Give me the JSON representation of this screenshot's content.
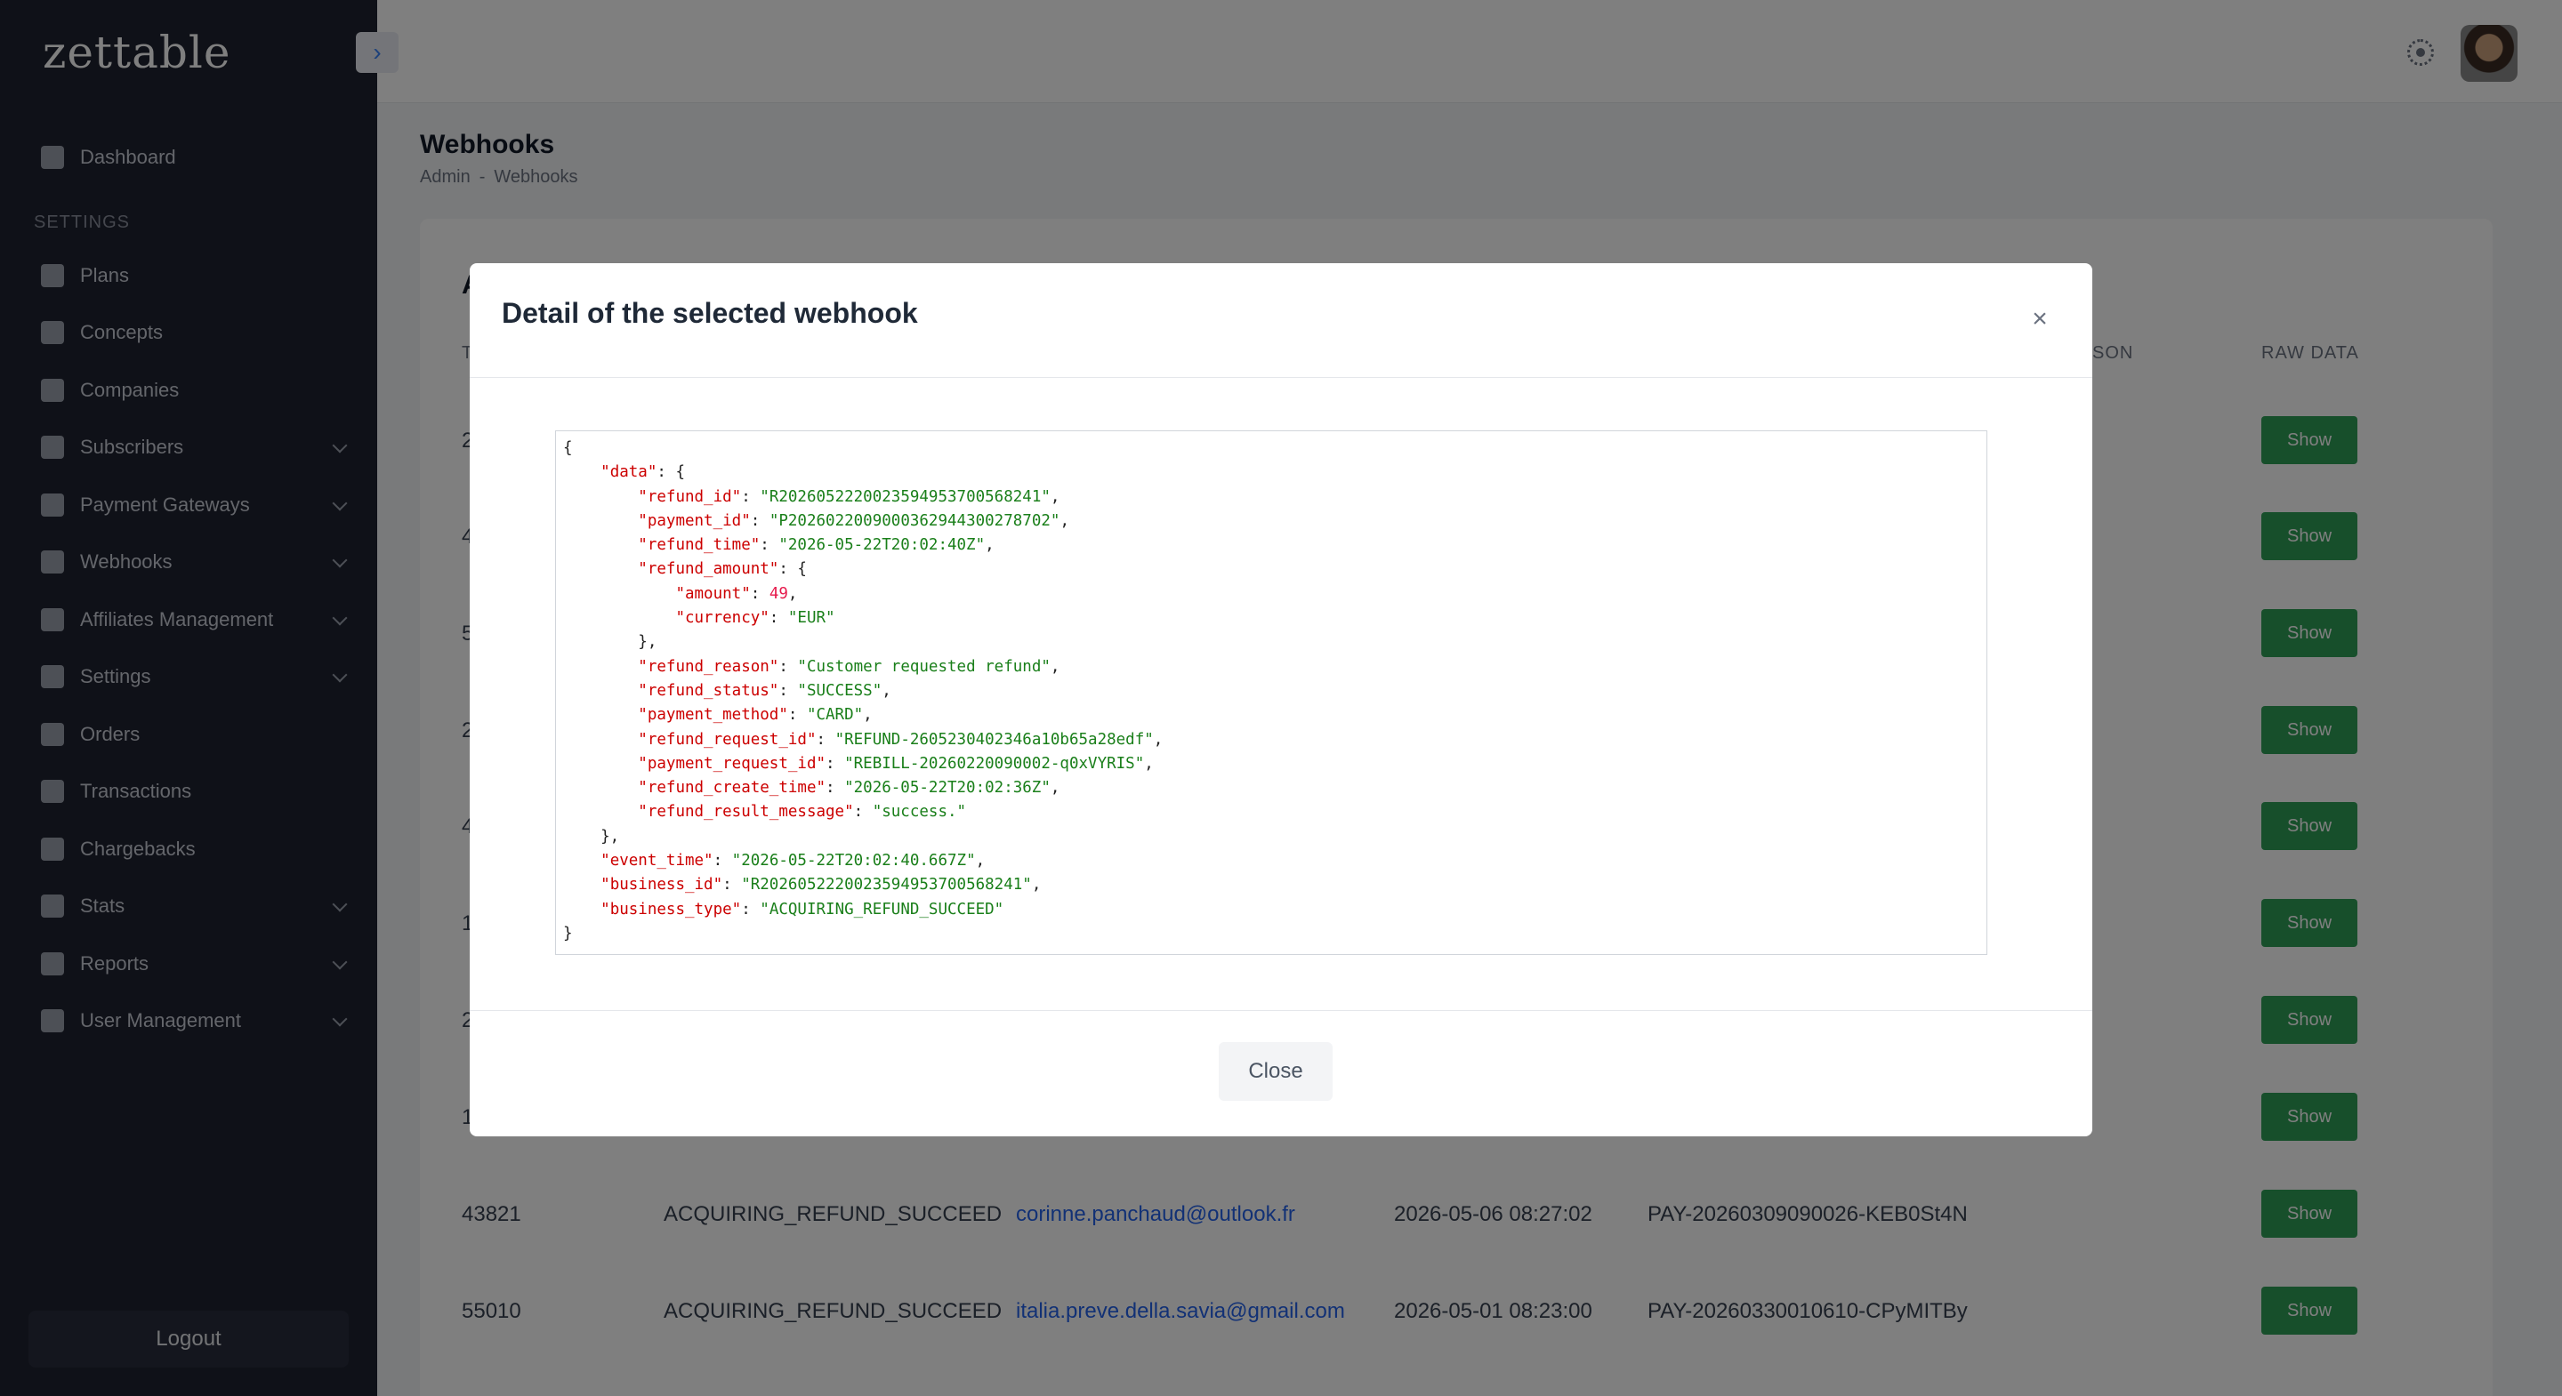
{
  "app": {
    "logo": "zettable"
  },
  "sidebar": {
    "section_label": "SETTINGS",
    "items": [
      {
        "label": "Dashboard",
        "icon": "dashboard-icon",
        "has_submenu": false
      },
      {
        "label": "Plans",
        "icon": "bank-icon",
        "has_submenu": false
      },
      {
        "label": "Concepts",
        "icon": "pie-chart-icon",
        "has_submenu": false
      },
      {
        "label": "Companies",
        "icon": "card-icon",
        "has_submenu": false
      },
      {
        "label": "Subscribers",
        "icon": "users-icon",
        "has_submenu": true
      },
      {
        "label": "Payment Gateways",
        "icon": "gateway-icon",
        "has_submenu": true
      },
      {
        "label": "Webhooks",
        "icon": "webhook-icon",
        "has_submenu": true
      },
      {
        "label": "Affiliates Management",
        "icon": "affiliate-icon",
        "has_submenu": true
      },
      {
        "label": "Settings",
        "icon": "gear-icon",
        "has_submenu": true
      },
      {
        "label": "Orders",
        "icon": "orders-icon",
        "has_submenu": false
      },
      {
        "label": "Transactions",
        "icon": "transactions-icon",
        "has_submenu": false
      },
      {
        "label": "Chargebacks",
        "icon": "chargeback-icon",
        "has_submenu": false
      },
      {
        "label": "Stats",
        "icon": "stats-icon",
        "has_submenu": true
      },
      {
        "label": "Reports",
        "icon": "bar-chart-icon",
        "has_submenu": true
      },
      {
        "label": "User Management",
        "icon": "user-management-icon",
        "has_submenu": true
      }
    ],
    "logout_label": "Logout"
  },
  "page": {
    "title": "Webhooks",
    "breadcrumb": [
      "Admin",
      "-",
      "Webhooks"
    ]
  },
  "table": {
    "card_title_visible": "A",
    "column_headers_visible": {
      "first": "T",
      "reason": "SON",
      "raw_data": "RAW DATA"
    },
    "partially_visible_first_col": [
      "2",
      "4",
      "5",
      "2",
      "4",
      "1",
      "2",
      "1"
    ],
    "rows": [
      {
        "id": "43821",
        "type": "ACQUIRING_REFUND_SUCCEED",
        "email": "corinne.panchaud@outlook.fr",
        "date": "2026-05-06 08:27:02",
        "reference": "PAY-20260309090026-KEB0St4N"
      },
      {
        "id": "55010",
        "type": "ACQUIRING_REFUND_SUCCEED",
        "email": "italia.preve.della.savia@gmail.com",
        "date": "2026-05-01 08:23:00",
        "reference": "PAY-20260330010610-CPyMITBy"
      }
    ],
    "show_label": "Show"
  },
  "modal": {
    "title": "Detail of the selected webhook",
    "close_label": "Close",
    "json": {
      "data": {
        "refund_id": "R2026052220023594953700568241",
        "payment_id": "P2026022009000362944300278702",
        "refund_time": "2026-05-22T20:02:40Z",
        "refund_amount": {
          "amount": 49,
          "currency": "EUR"
        },
        "refund_reason": "Customer requested refund",
        "refund_status": "SUCCESS",
        "payment_method": "CARD",
        "refund_request_id": "REFUND-2605230402346a10b65a28edf",
        "payment_request_id": "REBILL-20260220090002-q0xVYRIS",
        "refund_create_time": "2026-05-22T20:02:36Z",
        "refund_result_message": "success."
      },
      "event_time": "2026-05-22T20:02:40.667Z",
      "business_id": "R2026052220023594953700568241",
      "business_type": "ACQUIRING_REFUND_SUCCEED"
    }
  },
  "colors": {
    "sidebar_bg": "#1e2230",
    "show_button": "#2f9e57",
    "link": "#2563eb",
    "json_key": "#cc0000",
    "json_string": "#1a7f1a",
    "json_number": "#e6194b"
  }
}
